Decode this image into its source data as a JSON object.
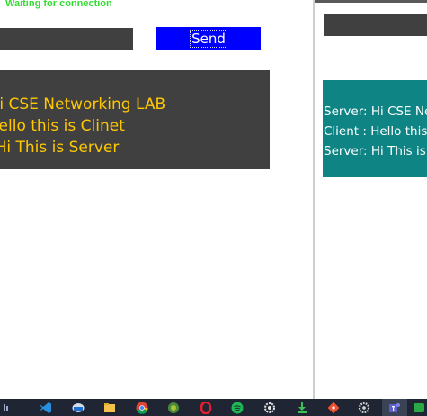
{
  "client_window": {
    "status": "Waiting for connection",
    "send_label": "Send",
    "messages": [
      "Server: Hi CSE Networking LAB",
      "Client : Hello this is Clinet",
      "Server: Hi This is Server"
    ]
  },
  "server_window": {
    "messages": [
      "Server: Hi CSE Networking LAB",
      "Client : Hello this is Clinet",
      "Server: Hi This is Server"
    ]
  },
  "taskbar": {
    "icons": [
      "visual-studio-code-icon",
      "mail-icon",
      "file-explorer-icon",
      "chrome-icon",
      "android-studio-icon",
      "opera-icon",
      "spotify-icon",
      "settings-icon",
      "download-app-icon",
      "git-icon",
      "gear-app-icon",
      "teams-icon",
      "chat-app-icon"
    ]
  },
  "colors": {
    "status_text": "#33dd33",
    "send_button": "#0000ff",
    "client_chat_bg": "#404040",
    "client_chat_text": "#ffc800",
    "server_chat_bg": "#0f8484",
    "server_chat_text": "#ffffff"
  }
}
